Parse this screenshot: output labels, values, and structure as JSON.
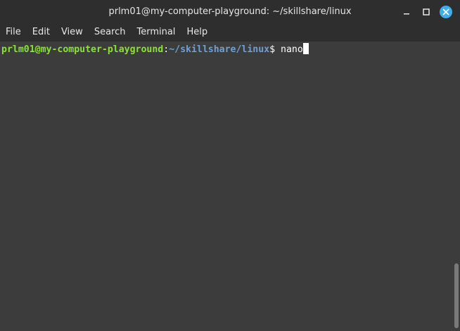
{
  "window": {
    "title": "prlm01@my-computer-playground: ~/skillshare/linux",
    "controls": {
      "minimize_icon": "minimize-icon",
      "maximize_icon": "maximize-icon",
      "close_icon": "close-icon",
      "close_color": "#3daee9"
    }
  },
  "menubar": {
    "items": [
      {
        "label": "File"
      },
      {
        "label": "Edit"
      },
      {
        "label": "View"
      },
      {
        "label": "Search"
      },
      {
        "label": "Terminal"
      },
      {
        "label": "Help"
      }
    ]
  },
  "terminal": {
    "prompt_user_host": "prlm01@my-computer-playground",
    "prompt_colon": ":",
    "prompt_path": "~/skillshare/linux",
    "prompt_dollar": "$ ",
    "command": "nano",
    "colors": {
      "user_host": "#8ae234",
      "path": "#729fcf",
      "background": "#3c3c3c"
    }
  }
}
